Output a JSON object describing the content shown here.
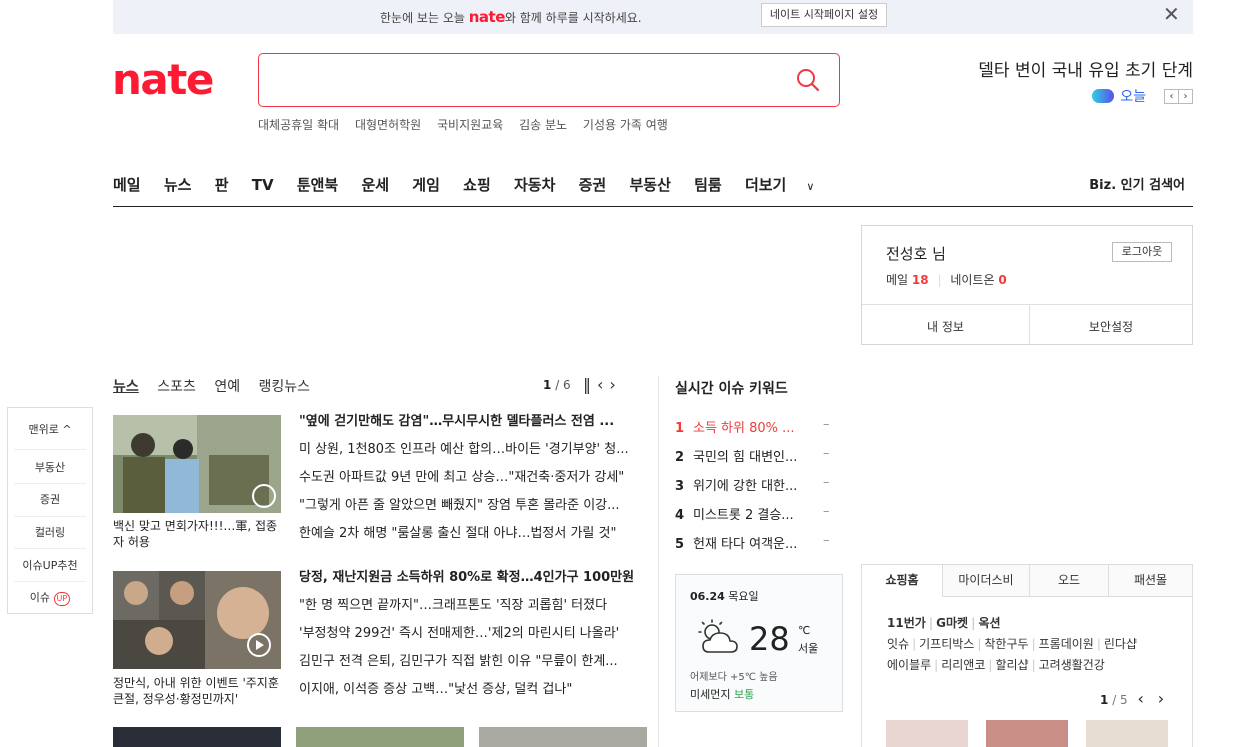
{
  "banner": {
    "prefix": "한눈에 보는 오늘",
    "logo": "nate",
    "suffix": "와 함께 하루를 시작하세요.",
    "button": "네이트 시작페이지 설정",
    "close": "✕"
  },
  "header": {
    "logo": "nate",
    "search_value": "",
    "keywords": [
      "대체공휴일 확대",
      "대형면허학원",
      "국비지원교육",
      "김송 분노",
      "기성용 가족 여행"
    ],
    "headline": "델타 변이 국내 유입 초기 단계",
    "today_label": "오늘"
  },
  "nav": {
    "items": [
      "메일",
      "뉴스",
      "판",
      "TV",
      "툰앤북",
      "운세",
      "게임",
      "쇼핑",
      "자동차",
      "증권",
      "부동산",
      "팀룸",
      "더보기"
    ],
    "biz": "Biz. 인기 검색어"
  },
  "user": {
    "name": "전성호 님",
    "logout": "로그아웃",
    "mail_label": "메일",
    "mail_count": "18",
    "nateon_label": "네이트온",
    "nateon_count": "0",
    "myinfo": "내 정보",
    "security": "보안설정"
  },
  "news": {
    "tabs": [
      "뉴스",
      "스포츠",
      "연예",
      "랭킹뉴스"
    ],
    "page_current": "1",
    "page_total": "/ 6",
    "blocks": [
      {
        "caption": "백신 맞고 면회가자!!!…軍, 접종자 허용",
        "items": [
          "\"옆에 걷기만해도 감염\"…무시무시한 델타플러스 전염 ...",
          "미 상원, 1천80조 인프라 예산 합의…바이든 '경기부양' 청...",
          "수도권 아파트값 9년 만에 최고 상승…\"재건축·중저가 강세\"",
          "\"그렇게 아픈 줄 알았으면 빼줬지\" 장염 투혼 몰라준 이강...",
          "한예슬 2차 해명 \"룸살롱 출신 절대 아냐…법정서 가릴 것\""
        ]
      },
      {
        "caption": "정만식, 아내 위한 이벤트 '주지훈 큰절, 정우성·황정민까지'",
        "items": [
          "당정, 재난지원금 소득하위 80%로 확정…4인가구 100만원",
          "\"한 명 찍으면 끝까지\"…크래프톤도 '직장 괴롭힘' 터졌다",
          "'부정청약 299건' 즉시 전매제한…'제2의 마린시티 나올라'",
          "김민구 전격 은퇴, 김민구가 직접 밝힌 이유 \"무릎이 한계...",
          "이지애, 이석증 증상 고백…\"낯선 증상, 덜컥 겁나\""
        ]
      }
    ]
  },
  "realtime": {
    "title": "실시간 이슈 키워드",
    "items": [
      {
        "rank": "1",
        "text": "소득 하위 80% ...",
        "change": "–"
      },
      {
        "rank": "2",
        "text": "국민의 힘 대변인...",
        "change": "–"
      },
      {
        "rank": "3",
        "text": "위기에 강한 대한...",
        "change": "–"
      },
      {
        "rank": "4",
        "text": "미스트롯 2 결승...",
        "change": "–"
      },
      {
        "rank": "5",
        "text": "헌재 타다 여객운...",
        "change": "–"
      }
    ]
  },
  "weather": {
    "date": "06.24",
    "day": "목요일",
    "temp": "28",
    "unit": "℃",
    "city": "서울",
    "compare": "어제보다 +5℃ 높음",
    "dust_label": "미세먼지",
    "dust_value": "보통"
  },
  "sidebar": {
    "top": "맨위로",
    "items": [
      "부동산",
      "증권",
      "컬러링",
      "이슈UP추천"
    ],
    "issue": "이슈",
    "up": "UP"
  },
  "shopping": {
    "tabs": [
      "쇼핑홈",
      "마이더스비",
      "오드",
      "패션몰"
    ],
    "row1": [
      "11번가",
      "G마켓",
      "옥션"
    ],
    "row2": [
      "잇슈",
      "기프티박스",
      "착한구두",
      "프롬데이원",
      "린다샵"
    ],
    "row3": [
      "에이블루",
      "리리앤코",
      "할리샵",
      "고려생활건강"
    ],
    "page_current": "1",
    "page_total": "/ 5"
  },
  "colors": {
    "brand": "#ff1a33",
    "link": "#2f67e8",
    "rank1": "#f13b3b",
    "dust_good": "#2da44e"
  }
}
